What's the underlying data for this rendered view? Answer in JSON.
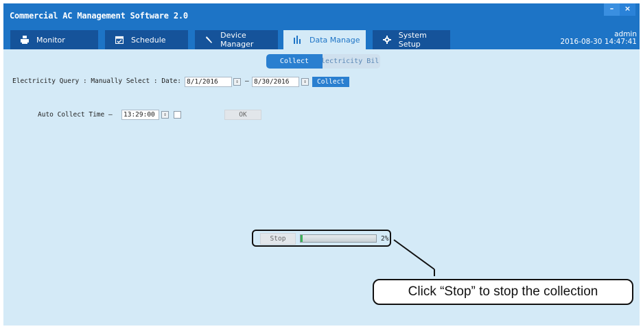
{
  "window": {
    "title": "Commercial AC Management Software 2.0",
    "minimize_glyph": "–",
    "close_glyph": "×"
  },
  "tabs": [
    {
      "label": "Monitor",
      "icon": "printer-icon",
      "active": false
    },
    {
      "label": "Schedule",
      "icon": "calendar-icon",
      "active": false
    },
    {
      "label": "Device Manager",
      "icon": "wrench-icon",
      "active": false
    },
    {
      "label": "Data Manage",
      "icon": "bar-chart-icon",
      "active": true
    },
    {
      "label": "System Setup",
      "icon": "gear-icon",
      "active": false
    }
  ],
  "user": {
    "name": "admin",
    "datetime": "2016-08-30 14:47:41"
  },
  "subtabs": {
    "active": "Collect",
    "inactive": "Electricity Bil"
  },
  "query": {
    "label": "Electricity  Query : Manually  Select : Date:",
    "date_from": "8/1/2016",
    "separator": "–",
    "date_to": "8/30/2016",
    "button": "Collect"
  },
  "auto": {
    "label": "Auto Collect   Time –",
    "time": "13:29:00",
    "ok_button": "OK"
  },
  "progress": {
    "stop_button": "Stop",
    "value": 0.02,
    "percent_label": "2%"
  },
  "callout": {
    "text": "Click “Stop” to stop the collection"
  },
  "colors": {
    "header": "#1d74c6",
    "tab": "#15539a",
    "background": "#d4eaf7",
    "accent_button": "#2a7fd0",
    "progress_fill": "#3bb25a"
  }
}
